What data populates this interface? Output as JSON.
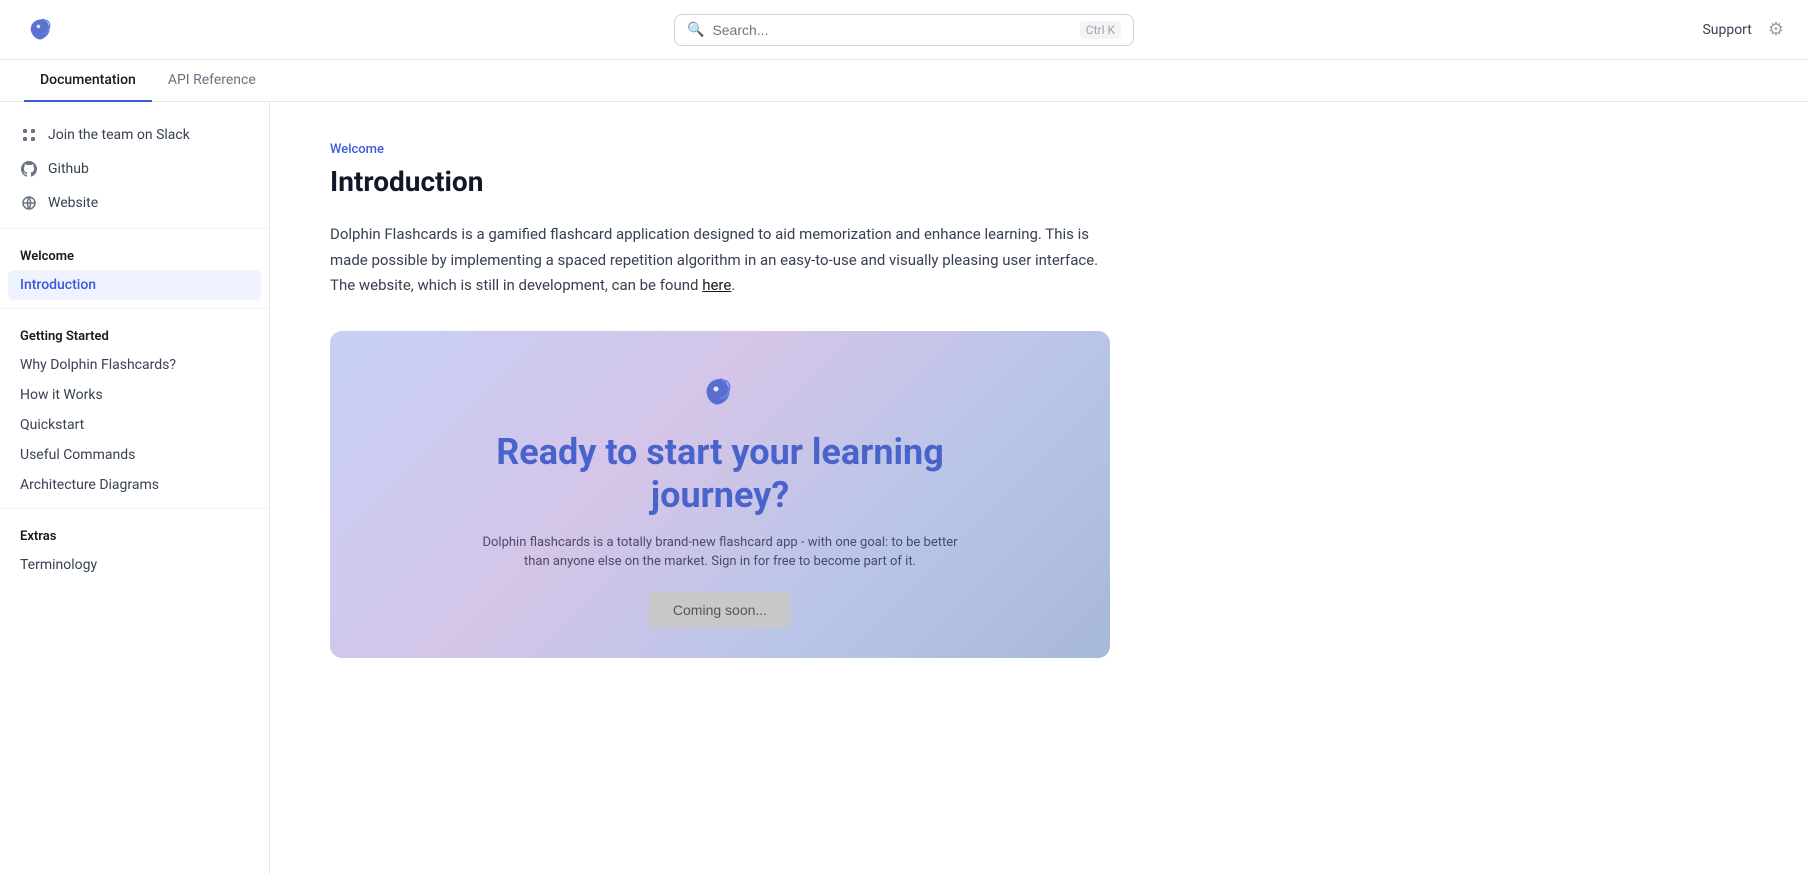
{
  "header": {
    "logo_alt": "Dolphin Flashcards logo",
    "search_placeholder": "Search...",
    "search_shortcut": "Ctrl K",
    "support_label": "Support",
    "settings_icon": "⚙"
  },
  "tabs": [
    {
      "label": "Documentation",
      "active": true
    },
    {
      "label": "API Reference",
      "active": false
    }
  ],
  "sidebar": {
    "quick_links": [
      {
        "icon": "slack",
        "label": "Join the team on Slack"
      },
      {
        "icon": "github",
        "label": "Github"
      },
      {
        "icon": "website",
        "label": "Website"
      }
    ],
    "sections": [
      {
        "title": "Welcome",
        "items": [
          {
            "label": "Introduction",
            "active": true
          }
        ]
      },
      {
        "title": "Getting Started",
        "items": [
          {
            "label": "Why Dolphin Flashcards?",
            "active": false
          },
          {
            "label": "How it Works",
            "active": false
          },
          {
            "label": "Quickstart",
            "active": false
          },
          {
            "label": "Useful Commands",
            "active": false
          },
          {
            "label": "Architecture Diagrams",
            "active": false
          }
        ]
      },
      {
        "title": "Extras",
        "items": [
          {
            "label": "Terminology",
            "active": false
          }
        ]
      }
    ]
  },
  "main": {
    "breadcrumb": "Welcome",
    "title": "Introduction",
    "description_parts": [
      "Dolphin Flashcards is a gamified flashcard application designed to aid memorization and enhance learning. This is made possible by implementing a spaced repetition algorithm in an easy-to-use and visually pleasing user interface. The website, which is still in development, can be found ",
      "here",
      "."
    ],
    "banner": {
      "title_line1": "Ready to start your learning",
      "title_line2": "journey?",
      "subtitle": "Dolphin flashcards is a totally brand-new flashcard app - with one goal: to be better than anyone else on the market. Sign in for free to become part of it.",
      "button_label": "Coming soon..."
    }
  }
}
